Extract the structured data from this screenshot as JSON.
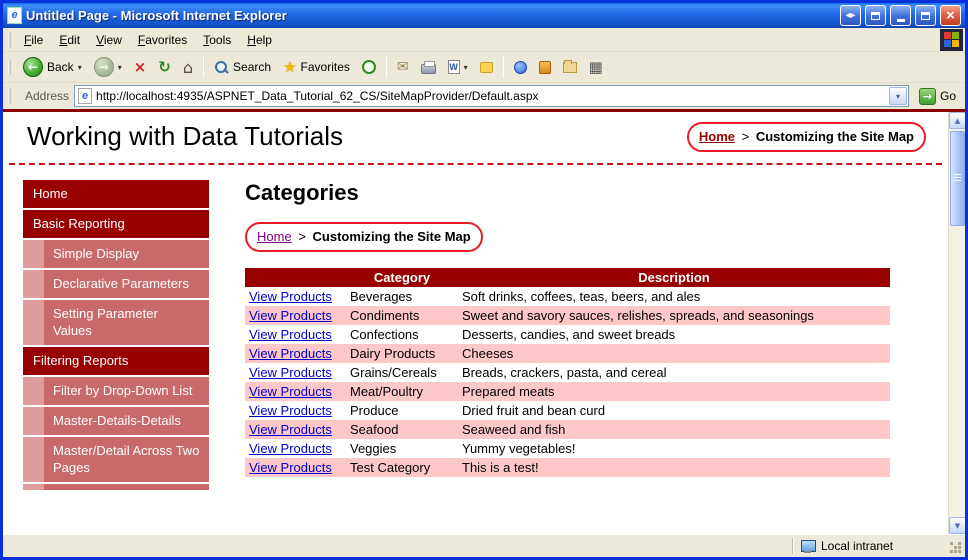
{
  "window": {
    "title": "Untitled Page - Microsoft Internet Explorer"
  },
  "menu_bar": {
    "items": [
      "File",
      "Edit",
      "View",
      "Favorites",
      "Tools",
      "Help"
    ]
  },
  "toolbar": {
    "back": "Back",
    "search": "Search",
    "favorites": "Favorites"
  },
  "address_bar": {
    "label": "Address",
    "url": "http://localhost:4935/ASPNET_Data_Tutorial_62_CS/SiteMapProvider/Default.aspx",
    "go": "Go"
  },
  "page": {
    "header": {
      "title": "Working with Data Tutorials"
    },
    "breadcrumb_top": {
      "home": "Home",
      "separator": ">",
      "current": "Customizing the Site Map"
    },
    "sidebar": {
      "items": [
        {
          "label": "Home",
          "level": 1
        },
        {
          "label": "Basic Reporting",
          "level": 1
        },
        {
          "label": "Simple Display",
          "level": 2
        },
        {
          "label": "Declarative Parameters",
          "level": 2
        },
        {
          "label": "Setting Parameter Values",
          "level": 2
        },
        {
          "label": "Filtering Reports",
          "level": 1
        },
        {
          "label": "Filter by Drop-Down List",
          "level": 2
        },
        {
          "label": "Master-Details-Details",
          "level": 2
        },
        {
          "label": "Master/Detail Across Two Pages",
          "level": 2
        }
      ]
    },
    "main": {
      "heading": "Categories",
      "breadcrumb": {
        "home": "Home",
        "separator": ">",
        "current": "Customizing the Site Map"
      },
      "table": {
        "headers": {
          "category": "Category",
          "description": "Description"
        },
        "link_label": "View Products",
        "rows": [
          {
            "category": "Beverages",
            "description": "Soft drinks, coffees, teas, beers, and ales"
          },
          {
            "category": "Condiments",
            "description": "Sweet and savory sauces, relishes, spreads, and seasonings"
          },
          {
            "category": "Confections",
            "description": "Desserts, candies, and sweet breads"
          },
          {
            "category": "Dairy Products",
            "description": "Cheeses"
          },
          {
            "category": "Grains/Cereals",
            "description": "Breads, crackers, pasta, and cereal"
          },
          {
            "category": "Meat/Poultry",
            "description": "Prepared meats"
          },
          {
            "category": "Produce",
            "description": "Dried fruit and bean curd"
          },
          {
            "category": "Seafood",
            "description": "Seaweed and fish"
          },
          {
            "category": "Veggies",
            "description": "Yummy vegetables!"
          },
          {
            "category": "Test Category",
            "description": "This is a test!"
          }
        ]
      }
    }
  },
  "status_bar": {
    "zone": "Local intranet"
  },
  "icons": {
    "ie_page": "e",
    "title_arrows": "◂▸",
    "close": "×",
    "back_arrow": "←",
    "forward_arrow": "→",
    "stop": "×",
    "refresh": "↻",
    "home": "⌂",
    "favorites_star": "★",
    "mail": "✉",
    "edit_w": "W",
    "menu_grid": "▦",
    "dropdown": "▾",
    "go_arrow": "→",
    "scroll_up": "▲",
    "scroll_down": "▼"
  },
  "colors": {
    "menu_dark_red": "#990000",
    "menu_sub_rose": "#C96A6A",
    "menu_indent_pink": "#DE9D9D",
    "table_header_red": "#990000",
    "row_pink": "#FFC8C8",
    "link_blue": "#0000CC",
    "visited_link": "#800080",
    "annotation_red": "#EC1C24",
    "page_rule_red": "#8B0000",
    "chrome_tan": "#ECE9D8",
    "titlebar_blue": "#2268E8"
  }
}
